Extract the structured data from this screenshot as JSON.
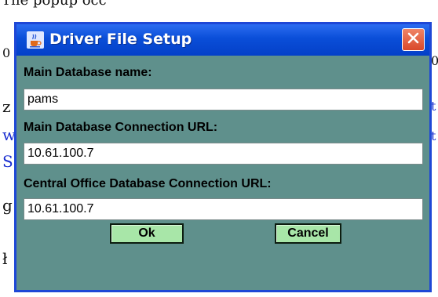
{
  "background": {
    "top_fragment": "The popup occ",
    "fragments": [
      "0",
      "z",
      "w",
      "S",
      "g",
      "ł",
      "0",
      "t",
      "t"
    ]
  },
  "dialog": {
    "title": "Driver File Setup",
    "title_icon": "java-cup-icon",
    "close_icon": "close-icon",
    "fields": [
      {
        "label": "Main Database name:",
        "value": "pams"
      },
      {
        "label": "Main Database Connection URL:",
        "value": "10.61.100.7"
      },
      {
        "label": "Central Office Database Connection URL:",
        "value": "10.61.100.7"
      }
    ],
    "buttons": {
      "ok": "Ok",
      "cancel": "Cancel"
    }
  },
  "colors": {
    "dialog_bg": "#5f908c",
    "title_bar": "#0a4ed8",
    "button_bg": "#a8e6a8",
    "close_bg": "#d9482a"
  }
}
